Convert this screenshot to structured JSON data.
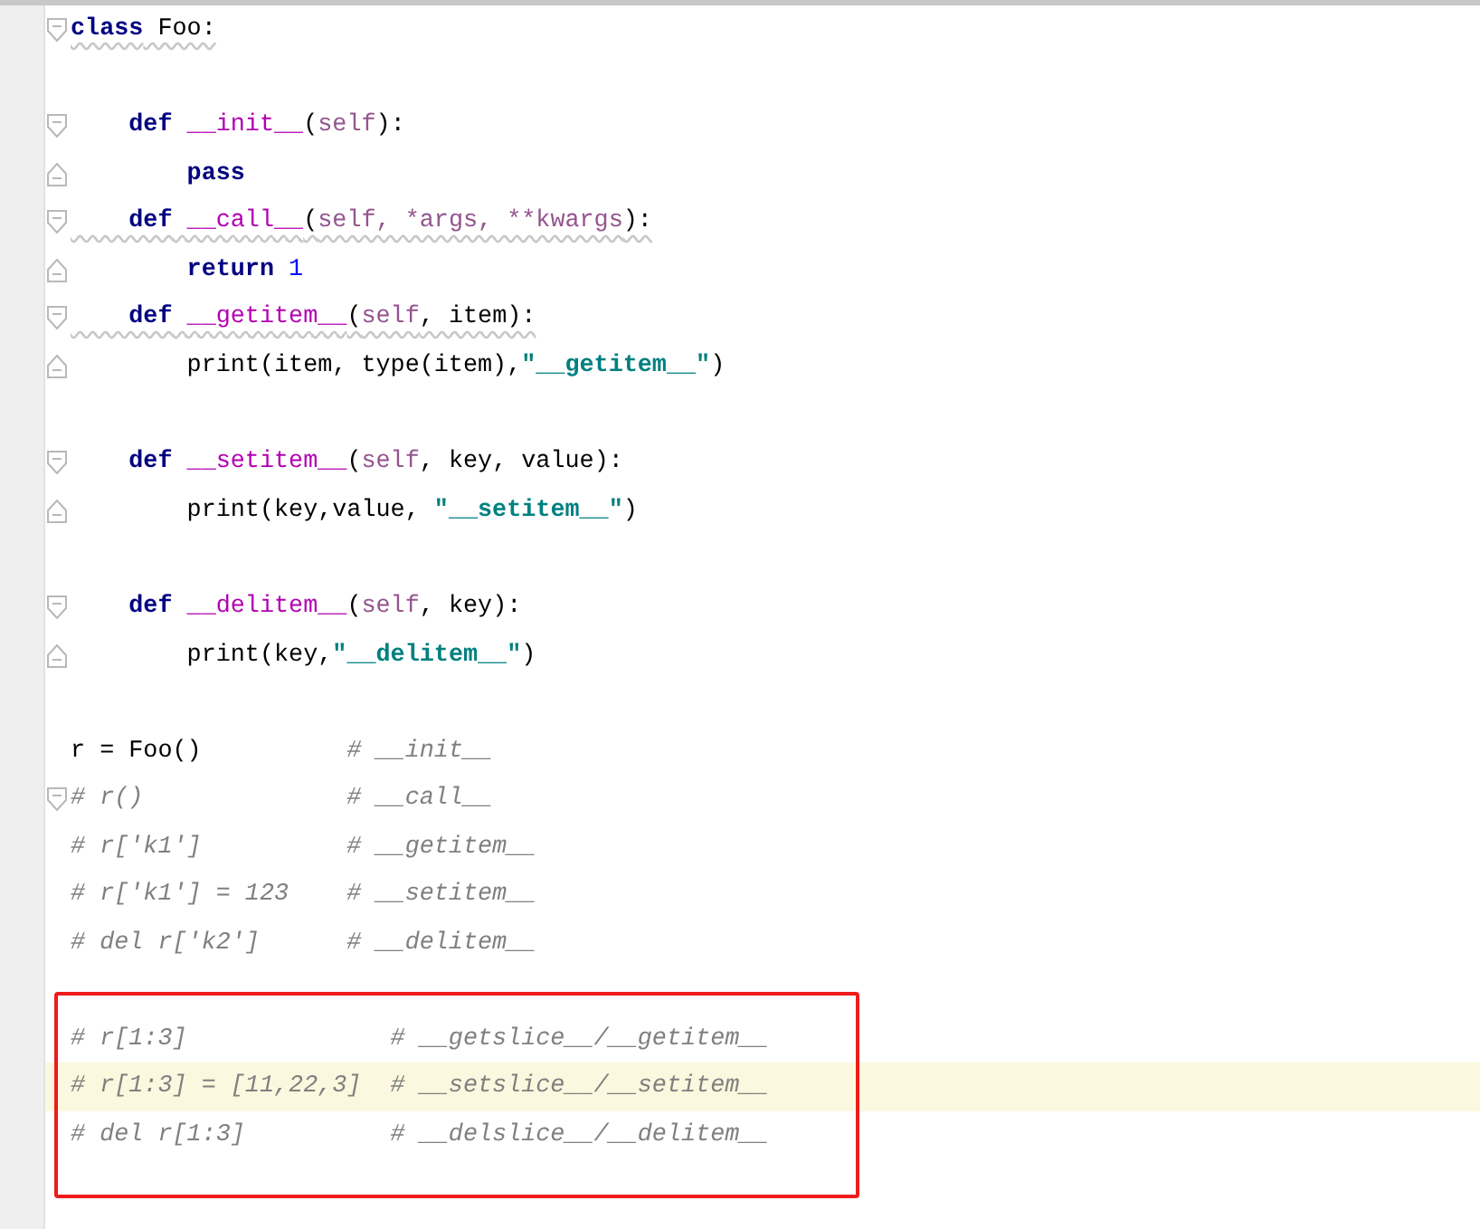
{
  "editor": {
    "lines": [
      {
        "kind": "code",
        "fold_start": true,
        "squiggly": true,
        "tokens": [
          {
            "kind": "keyword",
            "text": "class"
          },
          {
            "kind": "plain",
            "text": " Foo:"
          }
        ]
      },
      {
        "kind": "blank"
      },
      {
        "kind": "code",
        "fold_start": true,
        "tokens": [
          {
            "kind": "keyword",
            "text": "    def"
          },
          {
            "kind": "magic",
            "text": " __init__"
          },
          {
            "kind": "plain",
            "text": "("
          },
          {
            "kind": "self",
            "text": "self"
          },
          {
            "kind": "plain",
            "text": "):"
          }
        ]
      },
      {
        "kind": "code",
        "fold_end": true,
        "tokens": [
          {
            "kind": "keyword",
            "text": "        pass"
          }
        ]
      },
      {
        "kind": "code",
        "fold_start": true,
        "squiggly": true,
        "tokens": [
          {
            "kind": "keyword",
            "text": "    def"
          },
          {
            "kind": "magic",
            "text": " __call__"
          },
          {
            "kind": "plain",
            "text": "("
          },
          {
            "kind": "self",
            "text": "self, *args, **kwargs"
          },
          {
            "kind": "plain",
            "text": "):"
          }
        ]
      },
      {
        "kind": "code",
        "fold_end": true,
        "tokens": [
          {
            "kind": "keyword",
            "text": "        return"
          },
          {
            "kind": "number",
            "text": " 1"
          }
        ]
      },
      {
        "kind": "code",
        "fold_start": true,
        "squiggly": true,
        "tokens": [
          {
            "kind": "keyword",
            "text": "    def"
          },
          {
            "kind": "magic",
            "text": " __getitem__"
          },
          {
            "kind": "plain",
            "text": "("
          },
          {
            "kind": "self",
            "text": "self"
          },
          {
            "kind": "plain",
            "text": ", item):"
          }
        ]
      },
      {
        "kind": "code",
        "fold_end": true,
        "tokens": [
          {
            "kind": "plain",
            "text": "        print(item, type(item),"
          },
          {
            "kind": "string",
            "text": "\"__getitem__\""
          },
          {
            "kind": "plain",
            "text": ")"
          }
        ]
      },
      {
        "kind": "blank"
      },
      {
        "kind": "code",
        "fold_start": true,
        "tokens": [
          {
            "kind": "keyword",
            "text": "    def"
          },
          {
            "kind": "magic",
            "text": " __setitem__"
          },
          {
            "kind": "plain",
            "text": "("
          },
          {
            "kind": "self",
            "text": "self"
          },
          {
            "kind": "plain",
            "text": ", key, value):"
          }
        ]
      },
      {
        "kind": "code",
        "fold_end": true,
        "tokens": [
          {
            "kind": "plain",
            "text": "        print(key,value, "
          },
          {
            "kind": "string",
            "text": "\"__setitem__\""
          },
          {
            "kind": "plain",
            "text": ")"
          }
        ]
      },
      {
        "kind": "blank"
      },
      {
        "kind": "code",
        "fold_start": true,
        "tokens": [
          {
            "kind": "keyword",
            "text": "    def"
          },
          {
            "kind": "magic",
            "text": " __delitem__"
          },
          {
            "kind": "plain",
            "text": "("
          },
          {
            "kind": "self",
            "text": "self"
          },
          {
            "kind": "plain",
            "text": ", key):"
          }
        ]
      },
      {
        "kind": "code",
        "fold_end": true,
        "tokens": [
          {
            "kind": "plain",
            "text": "        print(key,"
          },
          {
            "kind": "string",
            "text": "\"__delitem__\""
          },
          {
            "kind": "plain",
            "text": ")"
          }
        ]
      },
      {
        "kind": "blank"
      },
      {
        "kind": "code",
        "tokens": [
          {
            "kind": "plain",
            "text": "r = Foo()          "
          },
          {
            "kind": "comment",
            "text": "# __init__"
          }
        ]
      },
      {
        "kind": "code",
        "fold_start": true,
        "tokens": [
          {
            "kind": "comment",
            "text": "# r()              # __call__"
          }
        ]
      },
      {
        "kind": "code",
        "tokens": [
          {
            "kind": "comment",
            "text": "# r['k1']          # __getitem__"
          }
        ]
      },
      {
        "kind": "code",
        "tokens": [
          {
            "kind": "comment",
            "text": "# r['k1'] = 123    # __setitem__"
          }
        ]
      },
      {
        "kind": "code",
        "tokens": [
          {
            "kind": "comment",
            "text": "# del r['k2']      # __delitem__"
          }
        ]
      }
    ],
    "boxed_lines": [
      {
        "kind": "code",
        "current": false,
        "tokens": [
          {
            "kind": "comment",
            "text": "# r[1:3]              # __getslice__/__getitem__"
          }
        ]
      },
      {
        "kind": "code",
        "current": true,
        "tokens": [
          {
            "kind": "comment",
            "text": "# r[1:3] = [11,22,3]  # __setslice__/__setitem__"
          }
        ]
      },
      {
        "kind": "code",
        "current": false,
        "tokens": [
          {
            "kind": "comment",
            "text": "# del r[1:3]          # __delslice__/__delitem__"
          }
        ]
      }
    ]
  }
}
